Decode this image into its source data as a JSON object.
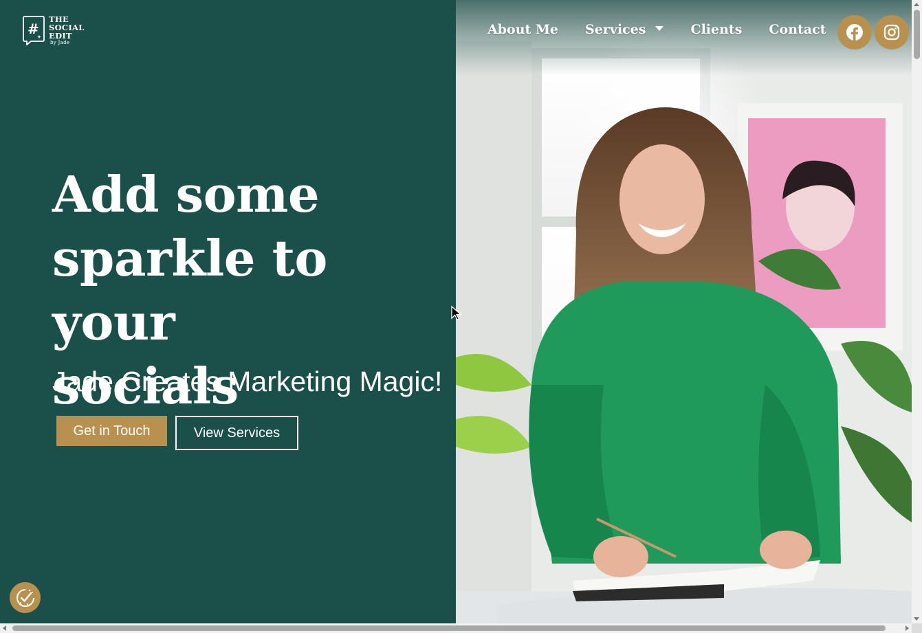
{
  "logo": {
    "line1": "THE",
    "line2": "SOCIAL",
    "line3": "EDIT",
    "line4": "by Jade",
    "mark": "#"
  },
  "nav": {
    "items": [
      {
        "label": "About Me"
      },
      {
        "label": "Services",
        "has_dropdown": true
      },
      {
        "label": "Clients"
      },
      {
        "label": "Contact"
      }
    ],
    "social": [
      {
        "icon": "facebook-icon"
      },
      {
        "icon": "instagram-icon"
      }
    ]
  },
  "hero": {
    "title_line1": "Add some",
    "title_line2": "sparkle to your",
    "title_line3": "socials",
    "subtitle": "Jade Creates Marketing Magic!",
    "primary_button": "Get in Touch",
    "secondary_button": "View Services"
  },
  "colors": {
    "panel": "#1b4f4a",
    "accent": "#b8914f",
    "text": "#ffffff"
  },
  "cookie_badge": {
    "icon": "cookie-consent-icon"
  }
}
